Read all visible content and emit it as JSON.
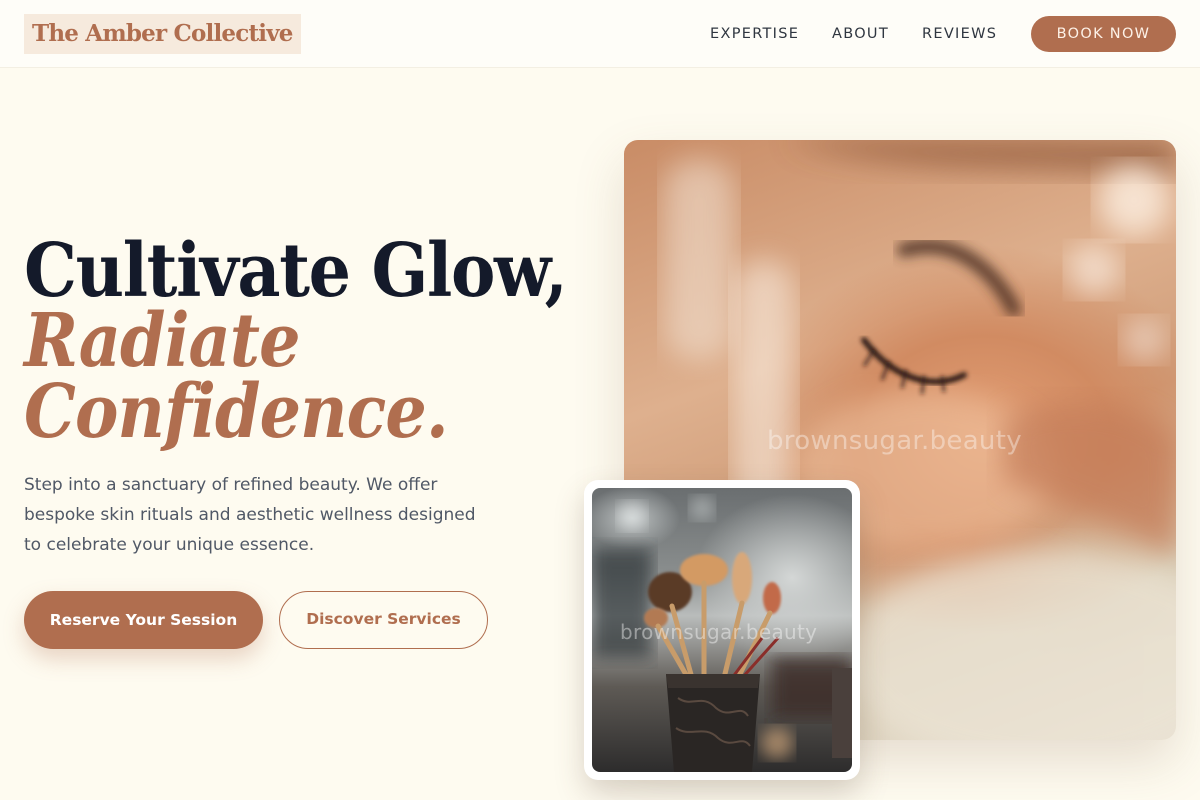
{
  "brand": {
    "name": "The Amber Collective",
    "accent_color": "#b06e4f",
    "text_color": "#141a2a",
    "background_color": "#fefbf0"
  },
  "nav": {
    "links": [
      {
        "label": "EXPERTISE"
      },
      {
        "label": "ABOUT"
      },
      {
        "label": "REVIEWS"
      }
    ],
    "cta_label": "BOOK NOW"
  },
  "hero": {
    "title_line1": "Cultivate Glow,",
    "title_line2": "Radiate",
    "title_line3": "Confidence.",
    "description": "Step into a sanctuary of refined beauty. We offer bespoke skin rituals and aesthetic wellness designed to celebrate your unique essence.",
    "primary_cta": "Reserve Your Session",
    "secondary_cta": "Discover Services"
  },
  "images": {
    "main": {
      "subject": "close-up of woman's face with closed eyes",
      "watermark": "brownsugar.beauty"
    },
    "secondary": {
      "subject": "makeup brushes in a holder",
      "watermark": "brownsugar.beauty"
    }
  }
}
